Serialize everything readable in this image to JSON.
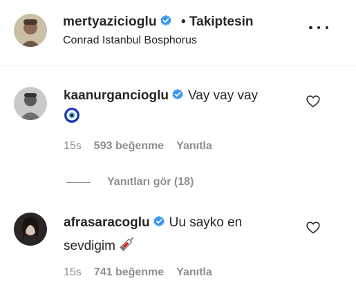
{
  "post": {
    "author": "mertyazicioglu",
    "separator": "•",
    "follow_status": "Takiptesin",
    "location": "Conrad Istanbul Bosphorus",
    "more_icon": "more-horizontal-icon"
  },
  "comments": [
    {
      "username": "kaanurgancioglu",
      "verified": true,
      "text": "Vay vay vay",
      "emoji": "🧿",
      "time": "15s",
      "likes": "593 beğenme",
      "reply_label": "Yanıtla",
      "view_replies": "Yanıtları gör (18)"
    },
    {
      "username": "afrasaracoglu",
      "verified": true,
      "text": "Uu sayko en sevdigim",
      "emoji": "💉",
      "time": "15s",
      "likes": "741 beğenme",
      "reply_label": "Yanıtla"
    }
  ],
  "colors": {
    "verified_badge": "#3897f0",
    "primary_text": "#262626",
    "secondary_text": "#8e8e8e",
    "divider": "#efefef"
  }
}
